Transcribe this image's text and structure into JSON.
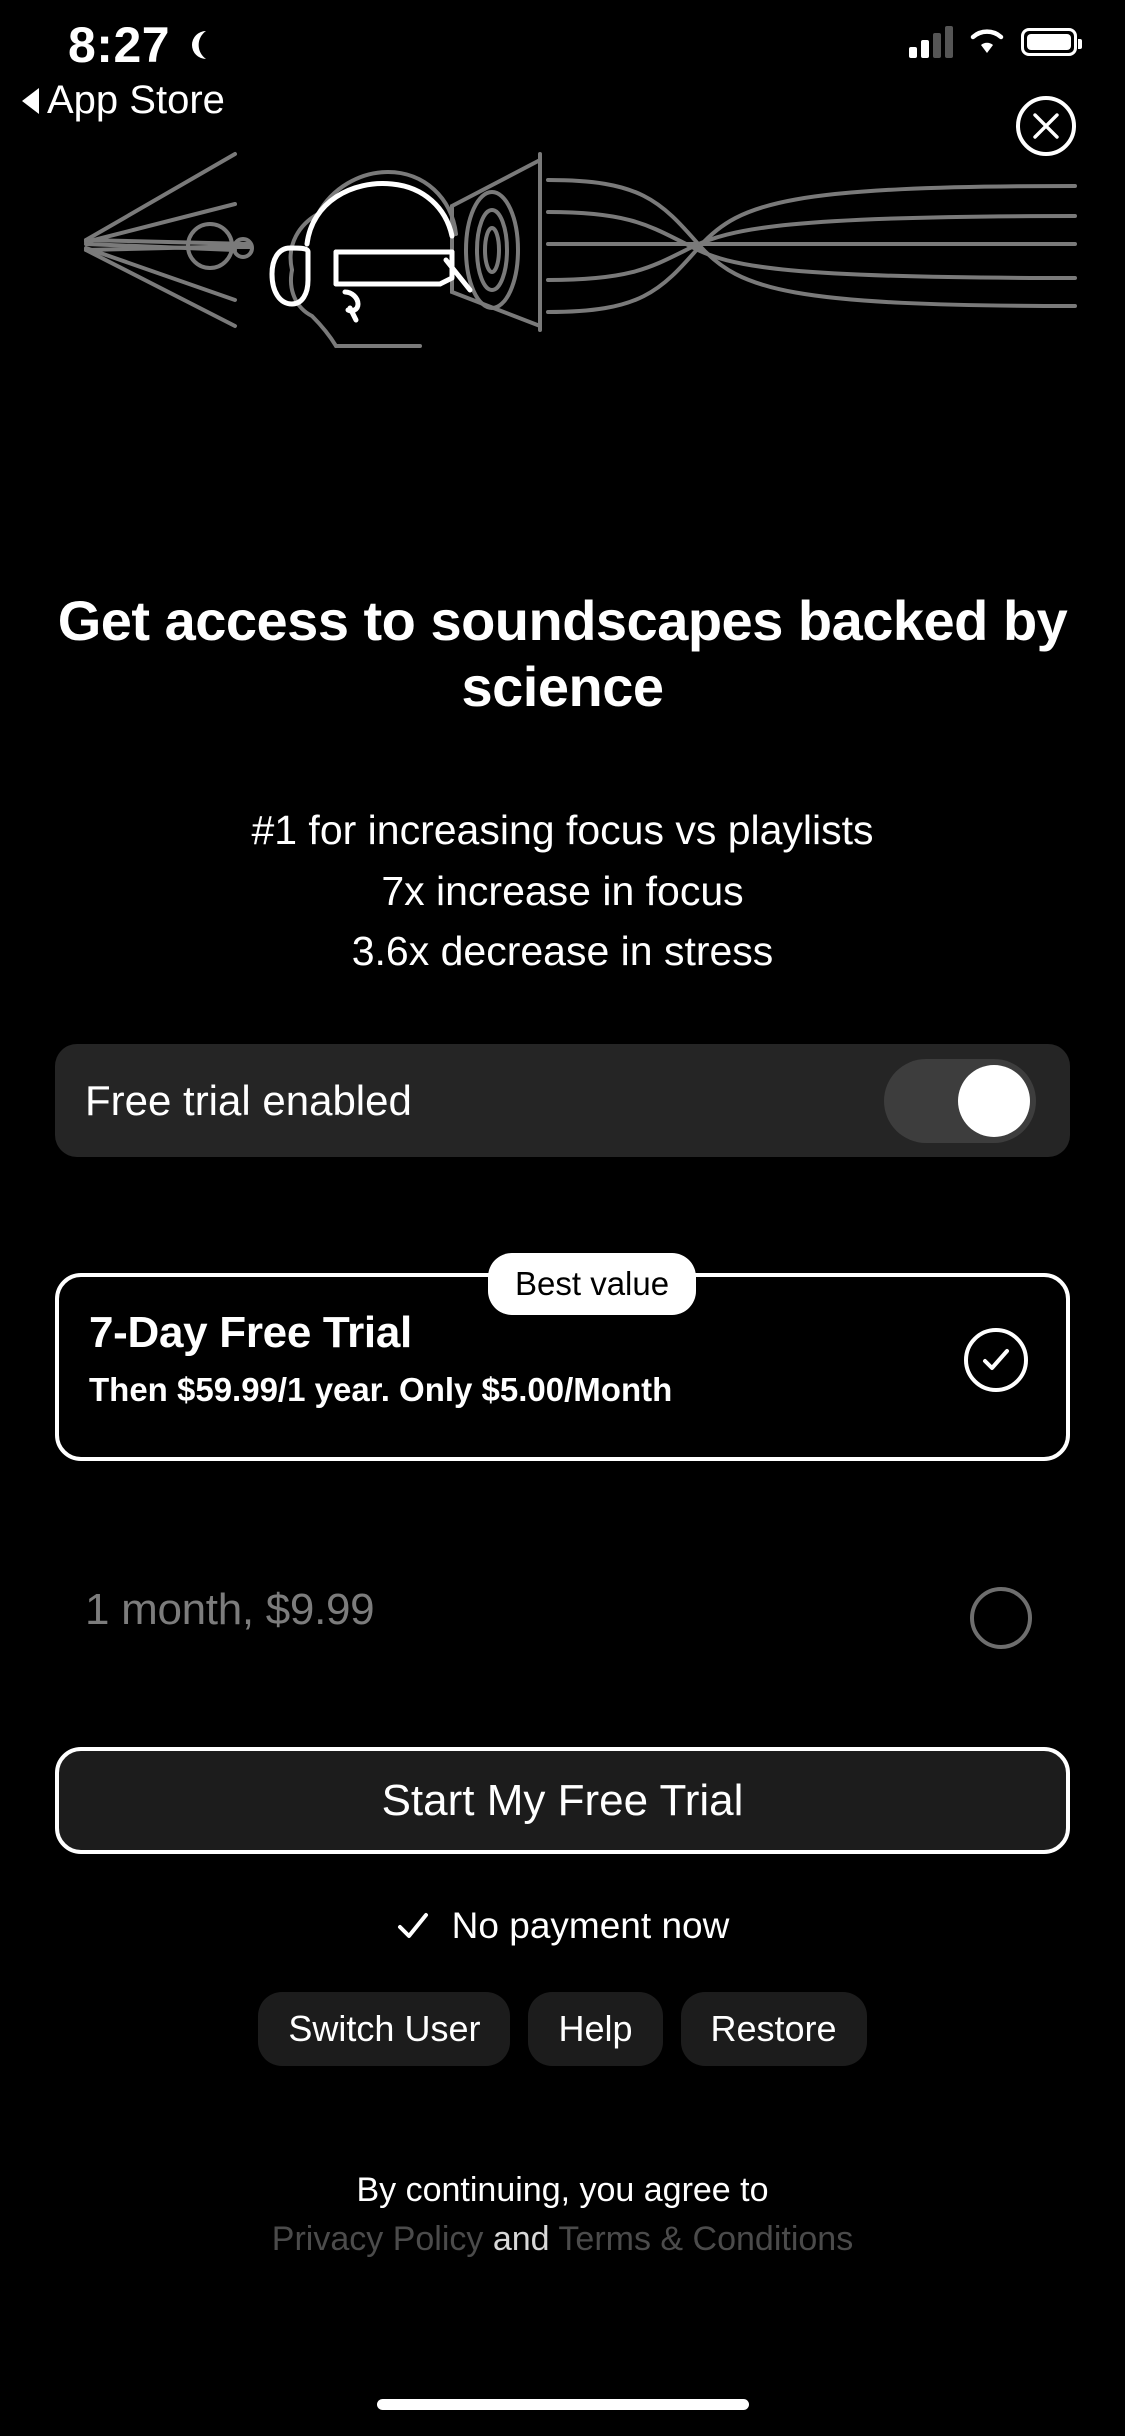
{
  "status_bar": {
    "time": "8:27",
    "moon_icon": "crescent-moon-icon",
    "signal_icon": "cellular-signal-icon",
    "wifi_icon": "wifi-icon",
    "battery_icon": "battery-icon"
  },
  "back_nav": {
    "label": "App Store",
    "icon": "back-triangle-icon"
  },
  "close": {
    "icon": "close-x-icon"
  },
  "hero": {
    "illustration_name": "person-wearing-vr-headset-soundwave-illustration"
  },
  "headline": "Get access to soundscapes backed by science",
  "benefits": [
    "#1 for increasing focus vs playlists",
    "7x increase in focus",
    "3.6x decrease in stress"
  ],
  "trial_toggle": {
    "label": "Free trial enabled",
    "enabled": true
  },
  "plans": {
    "best_value_badge": "Best value",
    "annual": {
      "title": "7-Day Free Trial",
      "subtitle": "Then $59.99/1 year. Only $5.00/Month",
      "selected": true,
      "check_icon": "check-circle-icon"
    },
    "monthly": {
      "title": "1 month, $9.99",
      "selected": false
    }
  },
  "cta": {
    "label": "Start My Free Trial"
  },
  "no_payment": {
    "label": "No payment now",
    "icon": "check-icon"
  },
  "footer_buttons": [
    {
      "label": "Switch User",
      "name": "switch-user-button"
    },
    {
      "label": "Help",
      "name": "help-button"
    },
    {
      "label": "Restore",
      "name": "restore-button"
    }
  ],
  "legal": {
    "line1": "By continuing, you agree to",
    "privacy_policy": "Privacy Policy",
    "and": "and",
    "terms": "Terms & Conditions"
  },
  "colors": {
    "background": "#000000",
    "card": "#252525",
    "button_dark": "#1c1c1c",
    "accent_white": "#ffffff",
    "muted_text": "#7c7c7c",
    "link_text": "#4b4b4b",
    "illustration_gray": "#7a7a7a"
  }
}
